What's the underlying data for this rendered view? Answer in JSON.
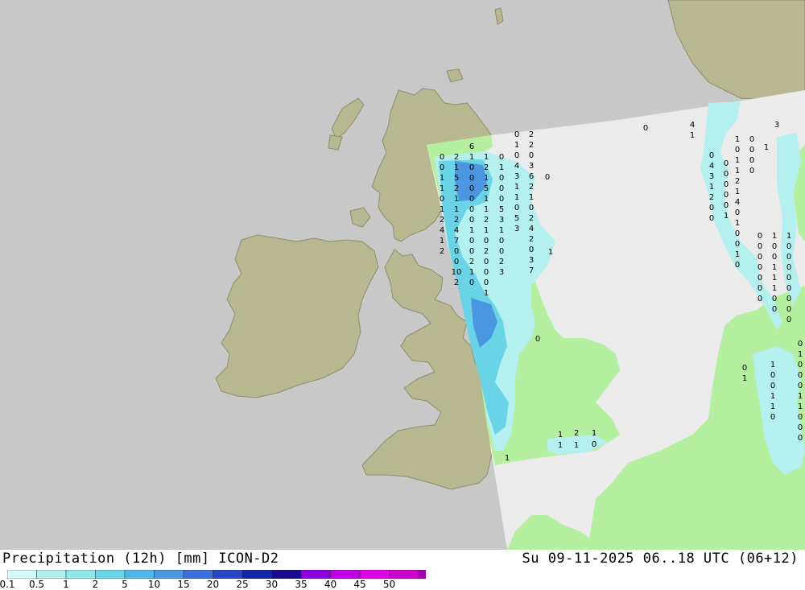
{
  "header": {
    "product_title": "Precipitation (12h) [mm] ICON-D2",
    "valid_time": "Su 09-11-2025 06..18 UTC (06+12)"
  },
  "legend": {
    "labels": [
      "0.1",
      "0.5",
      "1",
      "2",
      "5",
      "10",
      "15",
      "20",
      "25",
      "30",
      "35",
      "40",
      "45",
      "50"
    ],
    "colors": [
      "#d6fafa",
      "#b4f0f0",
      "#8ee6e6",
      "#6ad4e6",
      "#50b8e4",
      "#4a96e0",
      "#3c6edc",
      "#2846c8",
      "#1426a8",
      "#1a0a90",
      "#8c00e0",
      "#c000e6",
      "#e000e0",
      "#cc00cc",
      "#a000b0"
    ]
  },
  "map": {
    "colors": {
      "sea": "#c8c8c8",
      "land_outside": "#b8b890",
      "domain_sea": "#ebebeb",
      "domain_land": "#b4f0a0",
      "precip_light": "#b4f0f0",
      "precip_medium": "#6ad4e6",
      "precip_heavy": "#4a96e0"
    },
    "values": [
      "0",
      "0",
      "1",
      "1",
      "0",
      "1",
      "2",
      "4",
      "1",
      "2",
      "2",
      "1",
      "5",
      "2",
      "1",
      "1",
      "2",
      "4",
      "7",
      "0",
      "0",
      "10",
      "2",
      "6",
      "1",
      "0",
      "0",
      "0",
      "0",
      "0",
      "0",
      "1",
      "0",
      "0",
      "2",
      "1",
      "0",
      "1",
      "2",
      "1",
      "5",
      "1",
      "1",
      "2",
      "1",
      "0",
      "2",
      "0",
      "0",
      "0",
      "1",
      "0",
      "1",
      "0",
      "0",
      "0",
      "5",
      "3",
      "1",
      "0",
      "0",
      "2",
      "3",
      "0",
      "1",
      "0",
      "4",
      "3",
      "1",
      "1",
      "0",
      "5",
      "3",
      "2",
      "2",
      "0",
      "3",
      "6",
      "2",
      "1",
      "0",
      "2",
      "4",
      "2",
      "0",
      "3",
      "7",
      "4",
      "1",
      "0",
      "4",
      "3",
      "1",
      "2",
      "0",
      "0",
      "0",
      "0",
      "0",
      "0",
      "0",
      "1",
      "1",
      "0",
      "1",
      "1",
      "2",
      "1",
      "4",
      "0",
      "1",
      "0",
      "0",
      "1",
      "0",
      "0",
      "0",
      "0",
      "0",
      "1",
      "0",
      "0",
      "0",
      "0",
      "0",
      "0",
      "0",
      "1",
      "0",
      "0",
      "1",
      "1",
      "1",
      "0",
      "0",
      "1",
      "0",
      "0",
      "0",
      "0",
      "0",
      "0",
      "0",
      "0",
      "0",
      "1",
      "0",
      "0",
      "0",
      "1",
      "1",
      "0",
      "0",
      "0",
      "1",
      "0",
      "0",
      "1",
      "1",
      "0",
      "0",
      "1",
      "1",
      "2",
      "1",
      "1",
      "1",
      "0",
      "1",
      "0",
      "3",
      "0",
      "1",
      "0",
      "2",
      "1",
      "0",
      "0",
      "0",
      "0",
      "1",
      "0",
      "1",
      "0",
      "0",
      "0",
      "0",
      "1",
      "1",
      "0",
      "0",
      "1",
      "1",
      "0",
      "1",
      "1",
      "0",
      "2",
      "1",
      "2",
      "0",
      "2",
      "3",
      "1",
      "1",
      "0",
      "0",
      "0",
      "1",
      "0",
      "0",
      "0",
      "0"
    ]
  }
}
